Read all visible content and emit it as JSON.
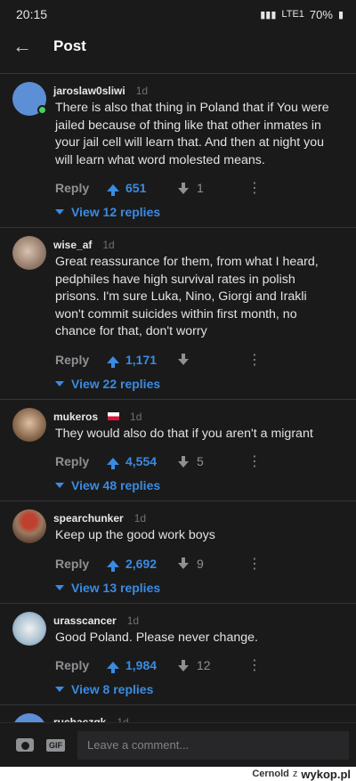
{
  "status": {
    "time": "20:15",
    "battery": "70%",
    "network": "LTE1"
  },
  "header": {
    "title": "Post"
  },
  "comments": [
    {
      "author": "jaroslaw0sliwi",
      "age": "1d",
      "online": true,
      "avatar_color": "#5d8fd6",
      "text": "There is also that thing in Poland that if You were jailed because of thing like that other inmates in your jail cell will learn that. And then at night you will learn what word molested means.",
      "reply": "Reply",
      "upvotes": "651",
      "downvotes": "1",
      "replies": "View 12 replies"
    },
    {
      "author": "wise_af",
      "age": "1d",
      "avatar_color": "#a89080",
      "text": "Great reassurance for them, from what I heard, pedphiles have high survival rates in polish prisons. I'm sure Luka, Nino, Giorgi and Irakli won't commit suicides within first month, no chance for that, don't worry",
      "reply": "Reply",
      "upvotes": "1,171",
      "downvotes": "",
      "replies": "View 22 replies"
    },
    {
      "author": "mukeros",
      "age": "1d",
      "flag": true,
      "avatar_color": "#b89a7a",
      "text": "They would also do that if you aren't a migrant",
      "reply": "Reply",
      "upvotes": "4,554",
      "downvotes": "5",
      "replies": "View 48 replies"
    },
    {
      "author": "spearchunker",
      "age": "1d",
      "avatar_color": "#8a6e5a",
      "text": "Keep up the good work boys",
      "reply": "Reply",
      "upvotes": "2,692",
      "downvotes": "9",
      "replies": "View 13 replies"
    },
    {
      "author": "urasscancer",
      "age": "1d",
      "avatar_color": "#9fb7c9",
      "text": "Good Poland. Please never change.",
      "reply": "Reply",
      "upvotes": "1,984",
      "downvotes": "12",
      "replies": "View 8 replies"
    },
    {
      "author": "ruchaczgk",
      "age": "1d",
      "avatar_color": "#5d8fd6"
    }
  ],
  "composer": {
    "placeholder": "Leave a comment..."
  },
  "watermark": {
    "user": "Cernold",
    "z": "z",
    "site": "wykop.pl"
  }
}
